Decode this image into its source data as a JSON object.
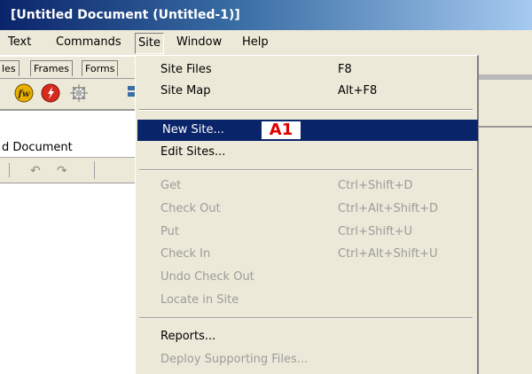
{
  "window": {
    "title": "[Untitled Document (Untitled-1)]"
  },
  "menubar": {
    "items": [
      {
        "label": "Text"
      },
      {
        "label": "Commands"
      },
      {
        "label": "Site"
      },
      {
        "label": "Window"
      },
      {
        "label": "Help"
      }
    ]
  },
  "insert_tabs": [
    "les",
    "Frames",
    "Forms"
  ],
  "toolbar_icons": [
    "flash-icon",
    "shockwave-icon",
    "generator-icon",
    "partial-icon"
  ],
  "document": {
    "title_partial": "d Document"
  },
  "site_menu": {
    "groups": [
      [
        {
          "label": "Site Files",
          "shortcut": "F8",
          "enabled": true
        },
        {
          "label": "Site Map",
          "shortcut": "Alt+F8",
          "enabled": true
        }
      ],
      [
        {
          "label": "New Site...",
          "shortcut": "",
          "enabled": true,
          "highlighted": true
        },
        {
          "label": "Edit Sites...",
          "shortcut": "",
          "enabled": true
        }
      ],
      [
        {
          "label": "Get",
          "shortcut": "Ctrl+Shift+D",
          "enabled": false
        },
        {
          "label": "Check Out",
          "shortcut": "Ctrl+Alt+Shift+D",
          "enabled": false
        },
        {
          "label": "Put",
          "shortcut": "Ctrl+Shift+U",
          "enabled": false
        },
        {
          "label": "Check In",
          "shortcut": "Ctrl+Alt+Shift+U",
          "enabled": false
        },
        {
          "label": "Undo Check Out",
          "shortcut": "",
          "enabled": false
        },
        {
          "label": "Locate in Site",
          "shortcut": "",
          "enabled": false
        }
      ],
      [
        {
          "label": "Reports...",
          "shortcut": "",
          "enabled": true
        },
        {
          "label": "Deploy Supporting Files...",
          "shortcut": "",
          "enabled": false
        }
      ]
    ]
  },
  "annotation": {
    "label": "A1"
  },
  "colors": {
    "highlight": "#0a246a",
    "annotation": "#e00000",
    "menu_bg": "#ece9d8",
    "disabled_text": "#9c9c9c"
  }
}
